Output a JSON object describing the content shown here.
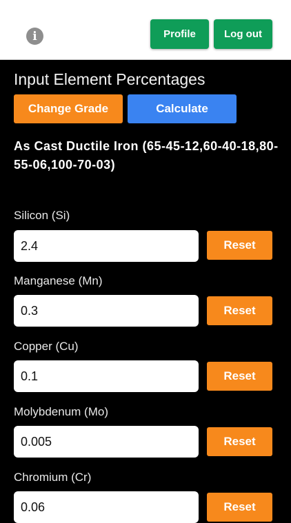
{
  "header": {
    "info_icon": "info-icon",
    "profile_label": "Profile",
    "logout_label": "Log out",
    "button_color": "#0f9d58"
  },
  "main": {
    "title": "Input Element Percentages",
    "change_grade_label": "Change Grade",
    "calculate_label": "Calculate",
    "grade_name": "As Cast Ductile Iron (65-45-12,60-40-18,80-55-06,100-70-03)",
    "accent_orange": "#f7891c",
    "accent_blue": "#3a83f1"
  },
  "elements": [
    {
      "label": "Silicon (Si)",
      "value": "2.4",
      "reset_label": "Reset"
    },
    {
      "label": "Manganese (Mn)",
      "value": "0.3",
      "reset_label": "Reset"
    },
    {
      "label": "Copper (Cu)",
      "value": "0.1",
      "reset_label": "Reset"
    },
    {
      "label": "Molybdenum (Mo)",
      "value": "0.005",
      "reset_label": "Reset"
    },
    {
      "label": "Chromium (Cr)",
      "value": "0.06",
      "reset_label": "Reset"
    }
  ]
}
